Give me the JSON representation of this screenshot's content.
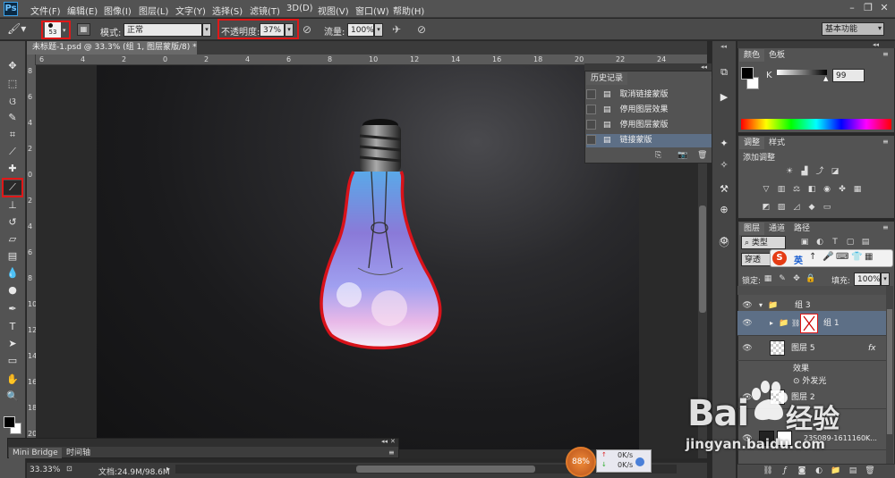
{
  "menu": [
    "文件(F)",
    "编辑(E)",
    "图像(I)",
    "图层(L)",
    "文字(Y)",
    "选择(S)",
    "滤镜(T)",
    "3D(D)",
    "视图(V)",
    "窗口(W)",
    "帮助(H)"
  ],
  "app_logo": "Ps",
  "options": {
    "brush_size": "53",
    "mode_label": "模式:",
    "mode_value": "正常",
    "opacity_label": "不透明度:",
    "opacity_value": "37%",
    "flow_label": "流量:",
    "flow_value": "100%",
    "workspace": "基本功能"
  },
  "document": {
    "tab_title": "未标题-1.psd @ 33.3% (组 1, 图层蒙版/8) *"
  },
  "ruler": {
    "h_ticks": [
      "6",
      "4",
      "2",
      "0",
      "2",
      "4",
      "6",
      "8",
      "10",
      "12",
      "14",
      "16",
      "18",
      "20",
      "22",
      "24"
    ],
    "v_ticks": [
      "8",
      "6",
      "4",
      "2",
      "0",
      "2",
      "4",
      "6",
      "8",
      "10",
      "12",
      "14",
      "16",
      "18",
      "20"
    ]
  },
  "status": {
    "zoom": "33.33%",
    "doc_info": "文档:24.9M/98.6M"
  },
  "minibridge": {
    "tab1": "Mini Bridge",
    "tab2": "时间轴"
  },
  "history": {
    "title": "历史记录",
    "items": [
      "取消链接蒙版",
      "停用图层效果",
      "停用图层蒙版",
      "链接蒙版"
    ]
  },
  "color_panel": {
    "tab_color": "颜色",
    "tab_swatches": "色板",
    "channel_label": "K",
    "channel_value": "99"
  },
  "adjust_panel": {
    "tab_adjust": "调整",
    "tab_styles": "样式",
    "add_label": "添加调整"
  },
  "layers_panel": {
    "tabs": [
      "图层",
      "通道",
      "路径"
    ],
    "filter_kind": "类型",
    "blend": "穿透",
    "lock_label": "锁定:",
    "fill_label": "填充:",
    "fill_value": "100%",
    "ime_label": "英",
    "rows": [
      {
        "name": "组 3",
        "type": "group"
      },
      {
        "name": "组 1",
        "type": "group-masked"
      },
      {
        "name": "图层 5",
        "type": "layer",
        "fx": "fx"
      },
      {
        "name": "效果",
        "type": "effect-header"
      },
      {
        "name": "外发光",
        "type": "effect"
      },
      {
        "name": "图层 2",
        "type": "layer"
      },
      {
        "name": "23S089-1611160K...",
        "type": "layer"
      }
    ]
  },
  "widget": {
    "percent": "88%",
    "up": "0K/s",
    "down": "0K/s"
  },
  "watermark": {
    "brand": "Bai",
    "brand2": "经验",
    "url": "jingyan.baidu.com"
  },
  "colors": {
    "accent_red": "#e01818",
    "panel": "#535353",
    "selected_row": "#5d6f86"
  }
}
